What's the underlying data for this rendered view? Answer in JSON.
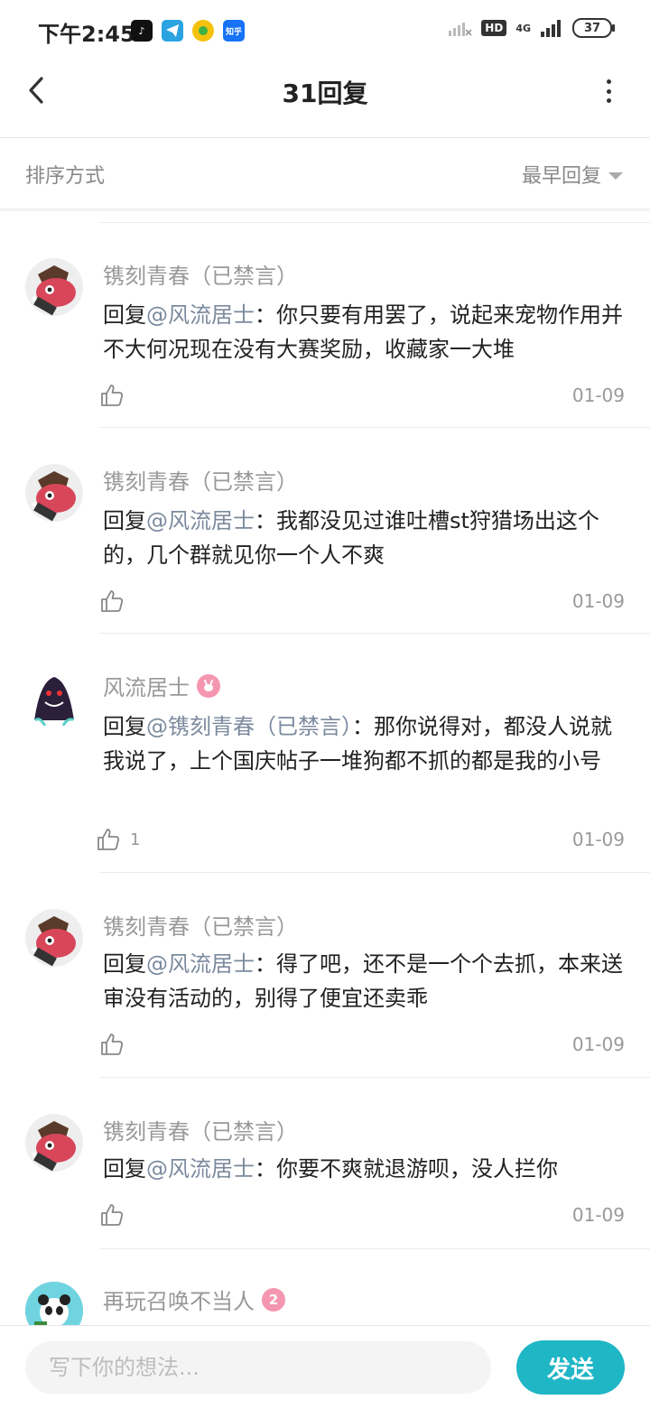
{
  "status_bar": {
    "time": "下午2:45",
    "app_icons": [
      "tiktok-icon",
      "telegram-icon",
      "qq-browser-icon",
      "zhihu-icon"
    ],
    "zhihu_label": "知乎",
    "hd": "HD",
    "network": "4G",
    "battery": "37"
  },
  "header": {
    "title": "31回复"
  },
  "sort": {
    "label": "排序方式",
    "selected": "最早回复"
  },
  "comments": [
    {
      "name": "镌刻青春（已禁言）",
      "reply_prefix": "回复",
      "mention": "@风流居士",
      "text": "：你只要有用罢了，说起来宠物作用并不大何况现在没有大赛奖励，收藏家一大堆",
      "likes": "",
      "date": "01-09"
    },
    {
      "name": "镌刻青春（已禁言）",
      "reply_prefix": "回复",
      "mention": "@风流居士",
      "text": "：我都没见过谁吐槽st狩猎场出这个的，几个群就见你一个人不爽",
      "likes": "",
      "date": "01-09"
    },
    {
      "name": "风流居士",
      "reply_prefix": "回复",
      "mention": "@镌刻青春（已禁言）",
      "text": "：那你说得对，都没人说就我说了，上个国庆帖子一堆狗都不抓的都是我的小号",
      "likes": "1",
      "date": "01-09"
    },
    {
      "name": "镌刻青春（已禁言）",
      "reply_prefix": "回复",
      "mention": "@风流居士",
      "text": "：得了吧，还不是一个个去抓，本来送审没有活动的，别得了便宜还卖乖",
      "likes": "",
      "date": "01-09"
    },
    {
      "name": "镌刻青春（已禁言）",
      "reply_prefix": "回复",
      "mention": "@风流居士",
      "text": "：你要不爽就退游呗，没人拦你",
      "likes": "",
      "date": "01-09"
    },
    {
      "name": "再玩召唤不当人",
      "badge": "2"
    }
  ],
  "footer": {
    "placeholder": "写下你的想法...",
    "send": "发送"
  },
  "colors": {
    "accent": "#1fb6c6",
    "mention": "#7b8a9e",
    "badge_pink": "#f596b0"
  }
}
